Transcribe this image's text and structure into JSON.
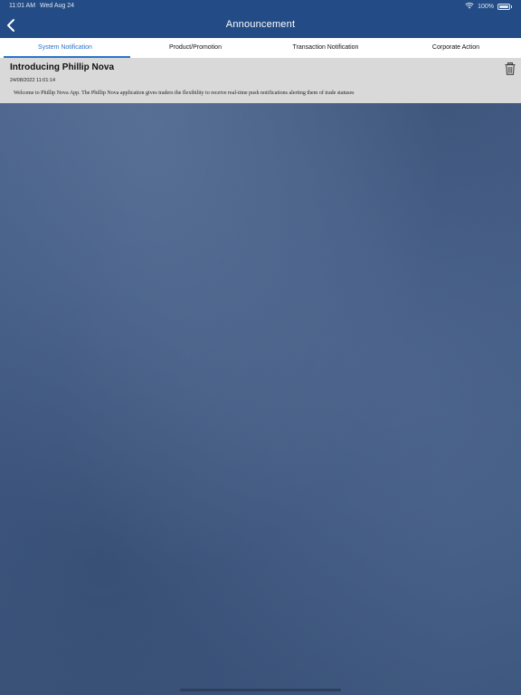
{
  "status_bar": {
    "time": "11:01 AM",
    "date": "Wed Aug 24",
    "battery": "100%"
  },
  "header": {
    "title": "Announcement"
  },
  "tabs": [
    {
      "label": "System Notification",
      "active": true
    },
    {
      "label": "Product/Promotion",
      "active": false
    },
    {
      "label": "Transaction Notification",
      "active": false
    },
    {
      "label": "Corporate Action",
      "active": false
    }
  ],
  "notification": {
    "title": "Introducing Phillip Nova",
    "date": "24/08/2022 11:01:14",
    "body": "Welcome to Phillip Nova App. The Phillip Nova application gives traders the flexibility to receive real-time push notifications alerting them of trade statuses"
  },
  "colors": {
    "header_bg": "#234c86",
    "active_tab": "#2a73c9",
    "card_bg": "#d9d9da"
  },
  "icons": [
    "back-chevron-icon",
    "wifi-icon",
    "battery-icon",
    "trash-icon"
  ]
}
